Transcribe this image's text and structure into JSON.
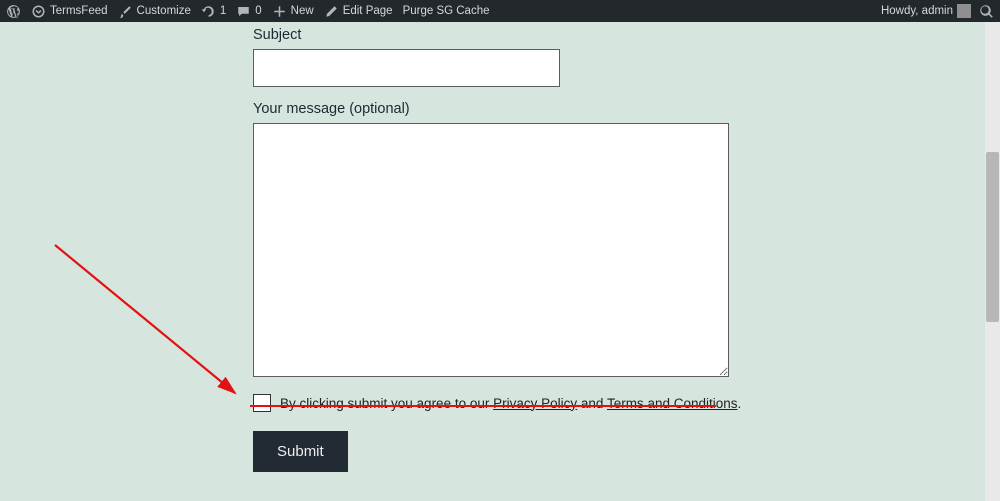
{
  "adminbar": {
    "site_name": "TermsFeed",
    "customize": "Customize",
    "updates": "1",
    "comments": "0",
    "new": "New",
    "edit_page": "Edit Page",
    "purge": "Purge SG Cache",
    "howdy": "Howdy, admin"
  },
  "form": {
    "subject_label": "Subject",
    "subject_value": "",
    "message_label": "Your message (optional)",
    "message_value": "",
    "consent_prefix": "By clicking submit you agree to our ",
    "privacy": "Privacy Policy",
    "consent_mid": " and ",
    "terms": "Terms and Conditions",
    "consent_end": ".",
    "submit": "Submit"
  }
}
